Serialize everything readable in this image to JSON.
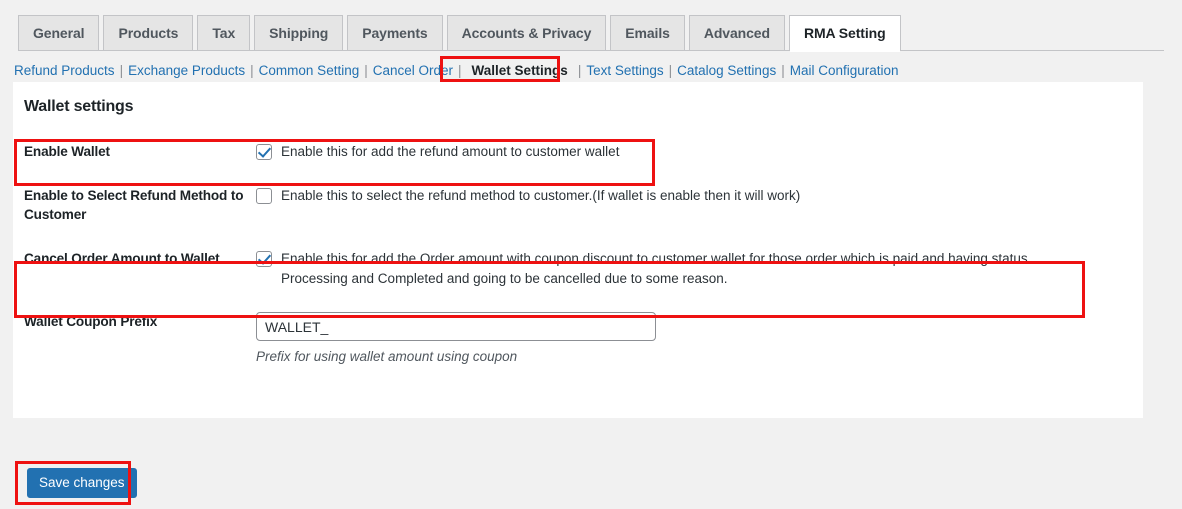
{
  "tabs": [
    {
      "label": "General",
      "active": false
    },
    {
      "label": "Products",
      "active": false
    },
    {
      "label": "Tax",
      "active": false
    },
    {
      "label": "Shipping",
      "active": false
    },
    {
      "label": "Payments",
      "active": false
    },
    {
      "label": "Accounts & Privacy",
      "active": false
    },
    {
      "label": "Emails",
      "active": false
    },
    {
      "label": "Advanced",
      "active": false
    },
    {
      "label": "RMA Setting",
      "active": true
    }
  ],
  "subnav": {
    "items": [
      {
        "label": "Refund Products",
        "current": false
      },
      {
        "label": "Exchange Products",
        "current": false
      },
      {
        "label": "Common Setting",
        "current": false
      },
      {
        "label": "Cancel Order",
        "current": false
      },
      {
        "label": "Wallet Settings",
        "current": true
      },
      {
        "label": "Text Settings",
        "current": false
      },
      {
        "label": "Catalog Settings",
        "current": false
      },
      {
        "label": "Mail Configuration",
        "current": false
      }
    ],
    "separator": "|"
  },
  "panel": {
    "title": "Wallet settings",
    "rows": [
      {
        "label": "Enable Wallet",
        "type": "checkbox",
        "checked": true,
        "description": "Enable this for add the refund amount to customer wallet"
      },
      {
        "label": "Enable to Select Refund Method to Customer",
        "type": "checkbox",
        "checked": false,
        "description": "Enable this to select the refund method to customer.(If wallet is enable then it will work)"
      },
      {
        "label": "Cancel Order Amount to Wallet",
        "type": "checkbox",
        "checked": true,
        "description": "Enable this for add the Order amount with coupon discount to customer wallet for those order which is paid and having status Processing and Completed and going to be cancelled due to some reason."
      },
      {
        "label": "Wallet Coupon Prefix",
        "type": "text",
        "value": "WALLET_",
        "description": "Prefix for using wallet amount using coupon"
      }
    ]
  },
  "save": {
    "label": "Save changes"
  },
  "colors": {
    "highlight": "#ee1111",
    "accent": "#2271b1",
    "link": "#2271b1",
    "page_background": "#f1f1f1",
    "panel_background": "#ffffff"
  }
}
